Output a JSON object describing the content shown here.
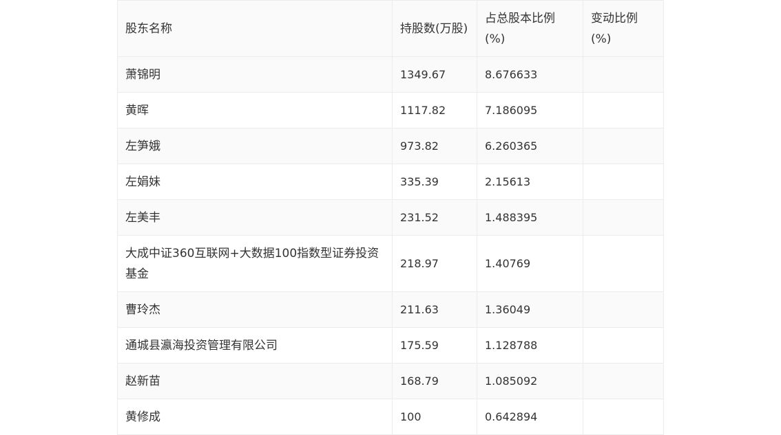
{
  "table": {
    "headers": [
      "股东名称",
      "持股数(万股)",
      "占总股本比例(%)",
      "变动比例(%)"
    ],
    "rows": [
      {
        "name": "萧锦明",
        "shares": "1349.67",
        "ratio": "8.676633",
        "change": ""
      },
      {
        "name": "黄晖",
        "shares": "1117.82",
        "ratio": "7.186095",
        "change": ""
      },
      {
        "name": "左笋娥",
        "shares": "973.82",
        "ratio": "6.260365",
        "change": ""
      },
      {
        "name": "左娟妹",
        "shares": "335.39",
        "ratio": "2.15613",
        "change": ""
      },
      {
        "name": "左美丰",
        "shares": "231.52",
        "ratio": "1.488395",
        "change": ""
      },
      {
        "name": "大成中证360互联网+大数据100指数型证券投资基金",
        "shares": "218.97",
        "ratio": "1.40769",
        "change": ""
      },
      {
        "name": "曹玲杰",
        "shares": "211.63",
        "ratio": "1.36049",
        "change": ""
      },
      {
        "name": "通城县瀛海投资管理有限公司",
        "shares": "175.59",
        "ratio": "1.128788",
        "change": ""
      },
      {
        "name": "赵新苗",
        "shares": "168.79",
        "ratio": "1.085092",
        "change": ""
      },
      {
        "name": "黄修成",
        "shares": "100",
        "ratio": "0.642894",
        "change": ""
      }
    ]
  }
}
